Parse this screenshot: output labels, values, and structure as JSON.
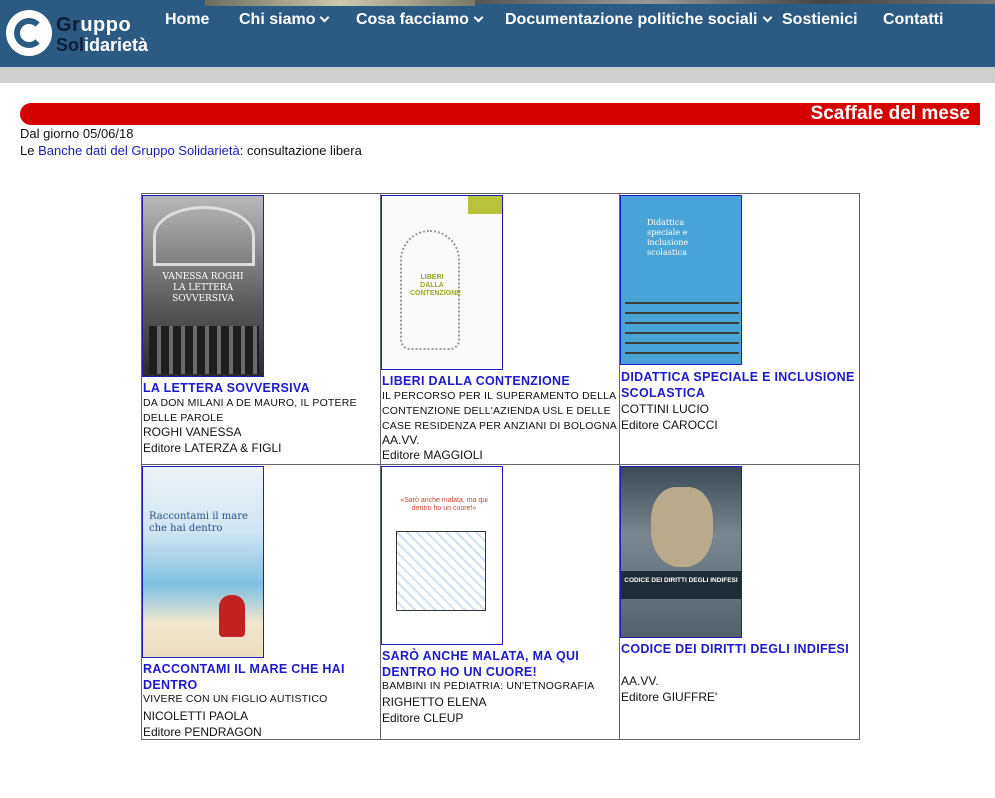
{
  "logo": {
    "line1_a": "Gr",
    "line1_b": "uppo",
    "line2_a": "Sol",
    "line2_b": "idarietà"
  },
  "nav": [
    {
      "label": "Home",
      "dropdown": false
    },
    {
      "label": "Chi siamo",
      "dropdown": true
    },
    {
      "label": "Cosa facciamo",
      "dropdown": true
    },
    {
      "label": "Documentazione politiche sociali",
      "dropdown": true
    },
    {
      "label": "Sostienici",
      "dropdown": false
    },
    {
      "label": "Contatti",
      "dropdown": false
    }
  ],
  "banner": {
    "title": "Scaffale del mese"
  },
  "date_line": "Dal giorno 05/06/18",
  "info": {
    "prefix": "Le ",
    "link": "Banche dati del Gruppo Solidarietà",
    "suffix": ": consultazione libera"
  },
  "books": [
    {
      "title": "LA LETTERA SOVVERSIVA",
      "subtitle": "DA DON MILANI A DE MAURO, IL POTERE DELLE PAROLE",
      "author": "ROGHI VANESSA",
      "publisher": "Editore LATERZA & FIGLI",
      "cover_text": "VANESSA ROGHI\nLA LETTERA\nSOVVERSIVA"
    },
    {
      "title": "LIBERI DALLA CONTENZIONE",
      "subtitle": "IL PERCORSO PER IL SUPERAMENTO DELLA CONTENZIONE DELL'AZIENDA USL E DELLE CASE RESIDENZA PER ANZIANI DI BOLOGNA",
      "author": "AA.VV.",
      "publisher": "Editore MAGGIOLI",
      "cover_text": "LIBERI DALLA CONTENZIONE"
    },
    {
      "title": "DIDATTICA SPECIALE E INCLUSIONE SCOLASTICA",
      "subtitle": "",
      "author": "COTTINI LUCIO",
      "publisher": "Editore CAROCCI",
      "cover_text": "Didattica speciale e inclusione scolastica"
    },
    {
      "title": "RACCONTAMI IL MARE CHE HAI DENTRO",
      "subtitle": "VIVERE CON UN FIGLIO AUTISTICO",
      "author": "NICOLETTI PAOLA",
      "publisher": "Editore PENDRAGON",
      "cover_text": "Raccontami il mare che hai dentro"
    },
    {
      "title": "SARÒ ANCHE MALATA, MA QUI DENTRO HO UN CUORE!",
      "subtitle": "BAMBINI IN PEDIATRIA: UN'ETNOGRAFIA",
      "author": "RIGHETTO ELENA",
      "publisher": "Editore CLEUP",
      "cover_text": "«Sarò anche malata, ma qui dentro ho un cuore!»"
    },
    {
      "title": "CODICE DEI DIRITTI DEGLI INDIFESI",
      "subtitle": "",
      "author": "AA.VV.",
      "publisher": "Editore GIUFFRE'",
      "cover_text": "CODICE DEI DIRITTI DEGLI INDIFESI"
    }
  ]
}
